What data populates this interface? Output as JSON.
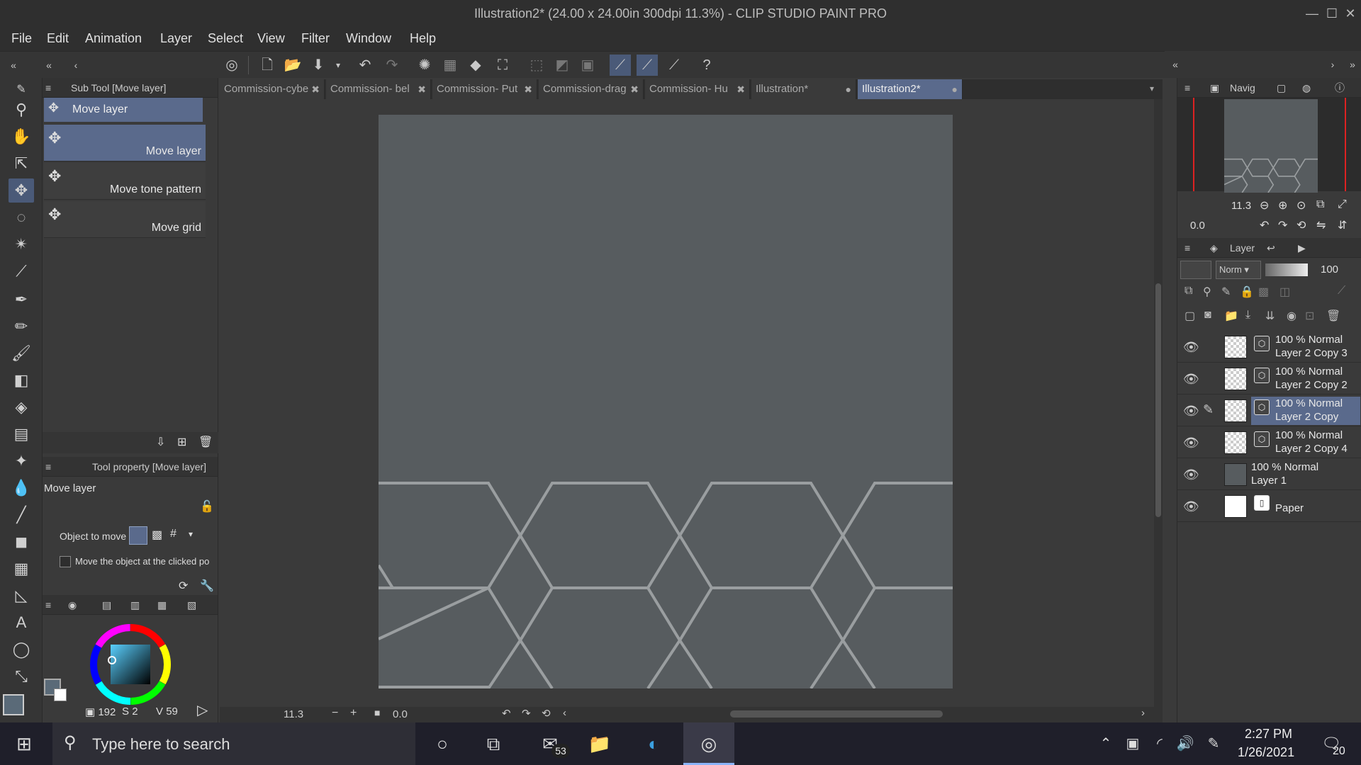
{
  "window": {
    "title": "Illustration2* (24.00 x 24.00in 300dpi 11.3%)  - CLIP STUDIO PAINT PRO",
    "minimize": "—",
    "maximize": "☐",
    "close": "✕"
  },
  "menu": [
    "File",
    "Edit",
    "Animation",
    "Layer",
    "Select",
    "View",
    "Filter",
    "Window",
    "Help"
  ],
  "subtool": {
    "header": "Sub Tool [Move layer]",
    "group_tab": "Move layer",
    "items": [
      {
        "label": "Move layer",
        "selected": true
      },
      {
        "label": "Move tone pattern",
        "selected": false
      },
      {
        "label": "Move grid",
        "selected": false
      }
    ]
  },
  "toolprop": {
    "header": "Tool property [Move layer]",
    "title": "Move layer",
    "object_to_move_label": "Object to move",
    "checkbox_label": "Move the object at the clicked po"
  },
  "color": {
    "h": "192",
    "s": "2",
    "v": "59",
    "main_color": "#5a6a78",
    "sub_color": "#ffffff"
  },
  "tabs": [
    {
      "label": "Commission-cybe",
      "active": false
    },
    {
      "label": "Commission- bel",
      "active": false
    },
    {
      "label": "Commission- Put",
      "active": false
    },
    {
      "label": "Commission-drag",
      "active": false
    },
    {
      "label": "Commission- Hu",
      "active": false
    },
    {
      "label": "Illustration*",
      "active": false
    },
    {
      "label": "Illustration2*",
      "active": true
    }
  ],
  "canvas": {
    "background": "#575c5f",
    "line_color": "#9a9ea0"
  },
  "status": {
    "zoom": "11.3",
    "rotation": "0.0"
  },
  "navigator": {
    "tab": "Navig",
    "zoom": "11.3",
    "rotation": "0.0"
  },
  "layer_panel": {
    "tab": "Layer",
    "blend_mode": "Norm",
    "opacity": "100",
    "layers": [
      {
        "mode": "100 % Normal",
        "name": "Layer 2 Copy 3",
        "selected": false,
        "vector": true,
        "fill": "checker"
      },
      {
        "mode": "100 % Normal",
        "name": "Layer 2 Copy 2",
        "selected": false,
        "vector": true,
        "fill": "checker"
      },
      {
        "mode": "100 % Normal",
        "name": "Layer 2 Copy",
        "selected": true,
        "vector": true,
        "fill": "checker"
      },
      {
        "mode": "100 % Normal",
        "name": "Layer 2 Copy 4",
        "selected": false,
        "vector": true,
        "fill": "checker"
      },
      {
        "mode": "100 % Normal",
        "name": "Layer 1",
        "selected": false,
        "vector": false,
        "fill": "#575c5f"
      },
      {
        "mode": "",
        "name": "Paper",
        "selected": false,
        "vector": false,
        "fill": "#ffffff"
      }
    ]
  },
  "taskbar": {
    "search_placeholder": "Type here to search",
    "mail_badge": "53",
    "time": "2:27 PM",
    "date": "1/26/2021",
    "notification_count": "20"
  }
}
